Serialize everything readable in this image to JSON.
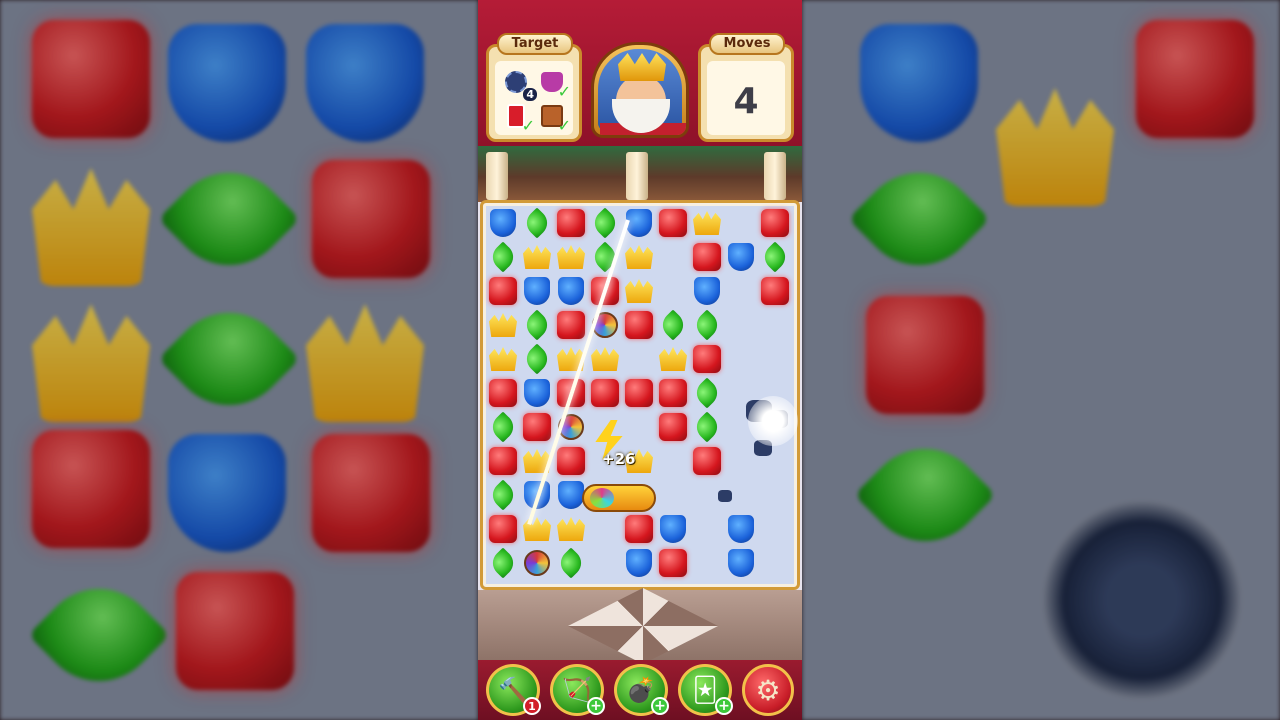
{
  "hud": {
    "target_label": "Target",
    "moves_label": "Moves",
    "moves_value": "4",
    "targets": [
      {
        "name": "bomb",
        "count": "4",
        "done": false
      },
      {
        "name": "pot",
        "done": true
      },
      {
        "name": "card",
        "done": true
      },
      {
        "name": "box",
        "done": true
      }
    ]
  },
  "board": {
    "score_popup": "+26",
    "rows": [
      [
        "blue",
        "green",
        "red",
        "green",
        "blue",
        "red",
        "gold",
        "",
        "red"
      ],
      [
        "green",
        "gold",
        "gold",
        "green",
        "gold",
        "",
        "red",
        "blue",
        "green"
      ],
      [
        "red",
        "blue",
        "blue",
        "red",
        "gold",
        "",
        "blue",
        "",
        "red"
      ],
      [
        "gold",
        "green",
        "red",
        "special",
        "red",
        "green",
        "green",
        "",
        ""
      ],
      [
        "gold",
        "green",
        "gold",
        "gold",
        "",
        "gold",
        "red",
        "",
        ""
      ],
      [
        "red",
        "blue",
        "red",
        "red",
        "red",
        "red",
        "green",
        "",
        ""
      ],
      [
        "green",
        "red",
        "special",
        "",
        "",
        "red",
        "green",
        "",
        ""
      ],
      [
        "red",
        "gold",
        "red",
        "",
        "gold",
        "",
        "red",
        "",
        ""
      ],
      [
        "green",
        "blue",
        "blue",
        "",
        "",
        "",
        "",
        "",
        ""
      ],
      [
        "red",
        "gold",
        "gold",
        "",
        "red",
        "blue",
        "",
        "blue",
        ""
      ],
      [
        "green",
        "special",
        "green",
        "",
        "blue",
        "red",
        "",
        "blue",
        ""
      ]
    ]
  },
  "boosters": [
    {
      "name": "hammer",
      "badge": "1"
    },
    {
      "name": "bow",
      "badge": "+"
    },
    {
      "name": "cannon",
      "badge": "+"
    },
    {
      "name": "jester",
      "badge": "+"
    }
  ],
  "colors": {
    "hud": "#b51c37",
    "board_border": "#d29a37",
    "accent_gold": "#f2c14a"
  }
}
